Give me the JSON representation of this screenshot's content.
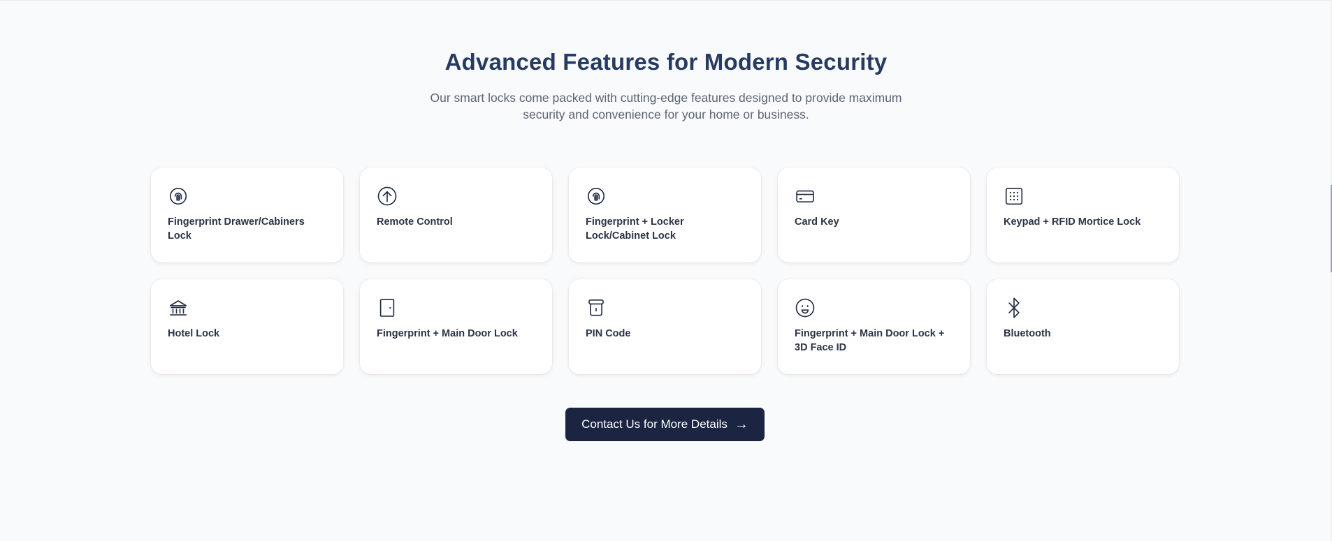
{
  "section": {
    "title": "Advanced Features for Modern Security",
    "subtitle": "Our smart locks come packed with cutting-edge features designed to provide maximum security and convenience for your home or business."
  },
  "features": [
    {
      "label": "Fingerprint Drawer/Cabiners Lock",
      "icon": "fingerprint-icon"
    },
    {
      "label": "Remote Control",
      "icon": "remote-control-icon"
    },
    {
      "label": "Fingerprint + Locker Lock/Cabinet Lock",
      "icon": "fingerprint-icon"
    },
    {
      "label": "Card Key",
      "icon": "card-key-icon"
    },
    {
      "label": "Keypad + RFID Mortice Lock",
      "icon": "keypad-icon"
    },
    {
      "label": "Hotel Lock",
      "icon": "hotel-icon"
    },
    {
      "label": "Fingerprint + Main Door Lock",
      "icon": "door-icon"
    },
    {
      "label": "PIN Code",
      "icon": "pin-code-icon"
    },
    {
      "label": "Fingerprint + Main Door Lock + 3D Face ID",
      "icon": "face-id-icon"
    },
    {
      "label": "Bluetooth",
      "icon": "bluetooth-icon"
    }
  ],
  "cta": {
    "label": "Contact Us for More Details",
    "arrow": "→"
  },
  "colors": {
    "background": "#f9fafb",
    "heading": "#263b63",
    "button": "#1b2541",
    "card": "#ffffff"
  }
}
